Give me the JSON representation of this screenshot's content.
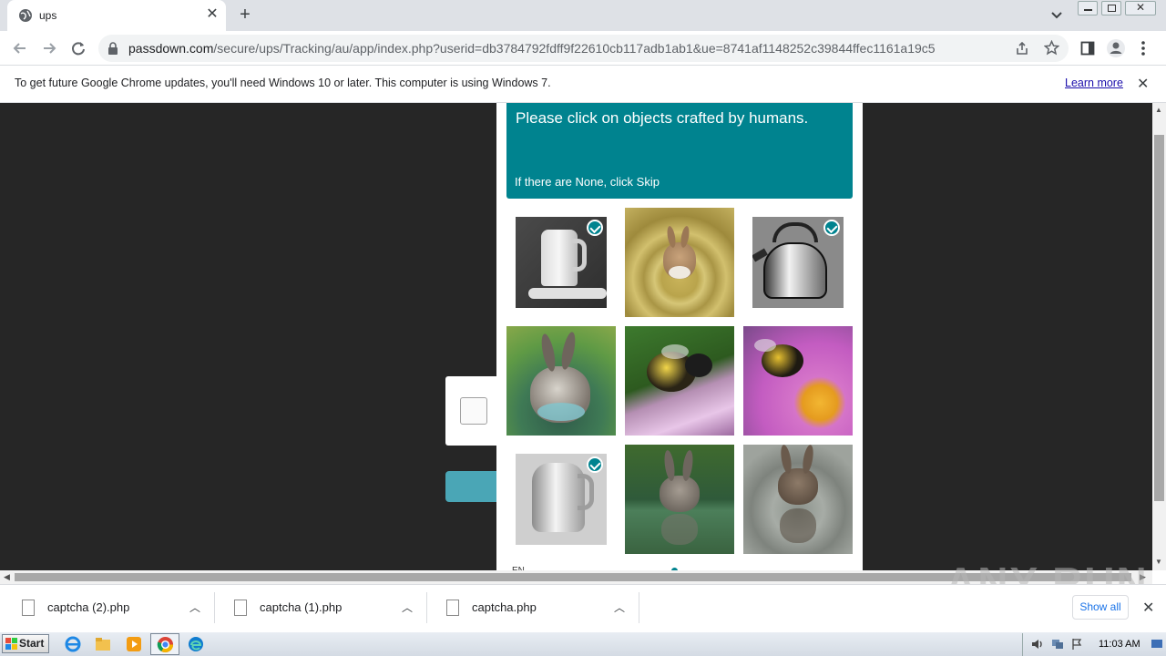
{
  "browser": {
    "tab_title": "ups",
    "url_domain": "passdown.com",
    "url_path": "/secure/ups/Tracking/au/app/index.php?userid=db3784792fdff9f22610cb117adb1ab1&ue=8741af1148252c39844ffec1161a19c5"
  },
  "infobar": {
    "message": "To get future Google Chrome updates, you'll need Windows 10 or later. This computer is using Windows 7.",
    "learn_more": "Learn more"
  },
  "captcha": {
    "title": "Please click on objects crafted by humans.",
    "subtitle": "If there are None, click Skip",
    "language": "EN",
    "images": [
      {
        "name": "kettle-white",
        "selected": true
      },
      {
        "name": "rabbit-in-water",
        "selected": false
      },
      {
        "name": "kettle-steel",
        "selected": true
      },
      {
        "name": "rabbit-in-water",
        "selected": false
      },
      {
        "name": "bee-on-flower",
        "selected": false
      },
      {
        "name": "bee-on-pink-flower",
        "selected": false
      },
      {
        "name": "kettle-white",
        "selected": true
      },
      {
        "name": "rabbit-in-water",
        "selected": false
      },
      {
        "name": "rabbit-in-water",
        "selected": false
      }
    ]
  },
  "downloads": {
    "items": [
      {
        "name": "captcha (2).php"
      },
      {
        "name": "captcha (1).php"
      },
      {
        "name": "captcha.php"
      }
    ],
    "show_all": "Show all"
  },
  "watermark": "ANY RUN",
  "taskbar": {
    "start_label": "Start",
    "clock": "11:03 AM"
  },
  "colors": {
    "captcha_accent": "#00838f",
    "page_background": "#262626"
  }
}
